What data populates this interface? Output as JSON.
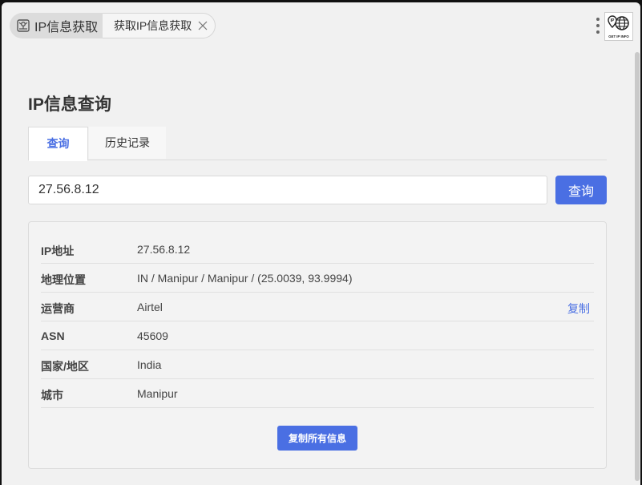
{
  "tabstrip": {
    "home_tab_label": "IP信息获取",
    "home_tab_icon": "map-network-icon",
    "active_tab_label": "获取IP信息获取",
    "close_icon": "close-icon",
    "menu_icon": "kebab-menu-icon",
    "extension_logo_text": "GET IP INFO"
  },
  "main": {
    "title": "IP信息查询",
    "tabs": [
      {
        "label": "查询",
        "active": true
      },
      {
        "label": "历史记录",
        "active": false
      }
    ],
    "ip_input_value": "27.56.8.12",
    "query_button_label": "查询"
  },
  "result": {
    "rows": [
      {
        "key": "IP地址",
        "value": "27.56.8.12"
      },
      {
        "key": "地理位置",
        "value": "IN / Manipur / Manipur / (25.0039, 93.9994)"
      },
      {
        "key": "运营商",
        "value": "Airtel",
        "action": "复制"
      },
      {
        "key": "ASN",
        "value": "45609"
      },
      {
        "key": "国家/地区",
        "value": "India"
      },
      {
        "key": "城市",
        "value": "Manipur"
      }
    ],
    "copy_all_label": "复制所有信息"
  },
  "colors": {
    "accent": "#4a6fe3",
    "background": "#f1f1f1",
    "card_background": "#f3f3f3"
  }
}
